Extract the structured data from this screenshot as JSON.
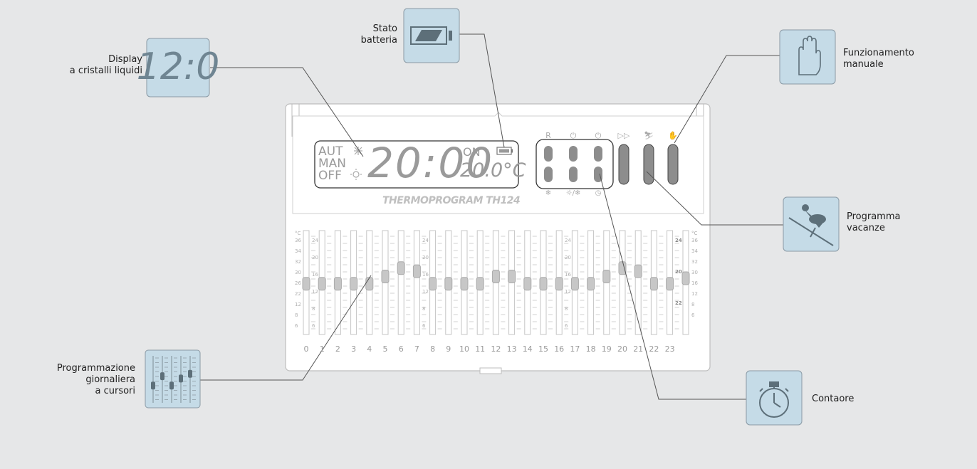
{
  "colors": {
    "background": "#e6e7e8",
    "icon_fill": "#c5dbe7",
    "icon_border": "#8a9aa5",
    "device_fill": "#ffffff",
    "device_line": "#bdbdbd",
    "lcd_text": "#9a9a9a",
    "leader_line": "#555555"
  },
  "callouts": {
    "display": {
      "label": "Display\na cristalli liquidi",
      "icon": "lcd-digits-icon",
      "icon_text": "12:0"
    },
    "battery": {
      "label": "Stato\nbatteria",
      "icon": "battery-icon"
    },
    "manual": {
      "label": "Funzionamento\nmanuale",
      "icon": "hand-icon"
    },
    "holiday": {
      "label": "Programma\nvacanze",
      "icon": "skier-icon"
    },
    "counter": {
      "label": "Contaore",
      "icon": "stopwatch-icon"
    },
    "sliders": {
      "label": "Programmazione\ngiornaliera\na cursori",
      "icon": "sliders-icon"
    }
  },
  "lcd": {
    "modes": [
      "AUT",
      "MAN",
      "OFF"
    ],
    "time": "20:00",
    "state": "ON",
    "temperature": "20.0°C",
    "snow_icon": "snowflake-icon",
    "sun_icon": "sun-icon"
  },
  "model_name": "THERMOPROGRAM TH124",
  "button_top_symbols": [
    "R",
    "⏻",
    "⏻",
    "▷▷",
    "skier",
    "hand"
  ],
  "button_bottom_symbols": [
    "antifreeze",
    "☼/❄",
    "clock"
  ],
  "hours": [
    "0",
    "1",
    "2",
    "3",
    "4",
    "5",
    "6",
    "7",
    "8",
    "9",
    "10",
    "11",
    "12",
    "13",
    "14",
    "15",
    "16",
    "17",
    "18",
    "19",
    "20",
    "21",
    "22",
    "23"
  ],
  "scale": {
    "unit": "°C",
    "left": [
      "36",
      "34",
      "32",
      "30",
      "26",
      "22",
      "12",
      "8",
      "6"
    ],
    "mid": [
      "24",
      "20",
      "16",
      "12",
      "8",
      "6"
    ],
    "right_bold": [
      "24",
      "20",
      "22"
    ],
    "right": [
      "36",
      "34",
      "32",
      "30",
      "16",
      "12",
      "8",
      "6"
    ]
  }
}
